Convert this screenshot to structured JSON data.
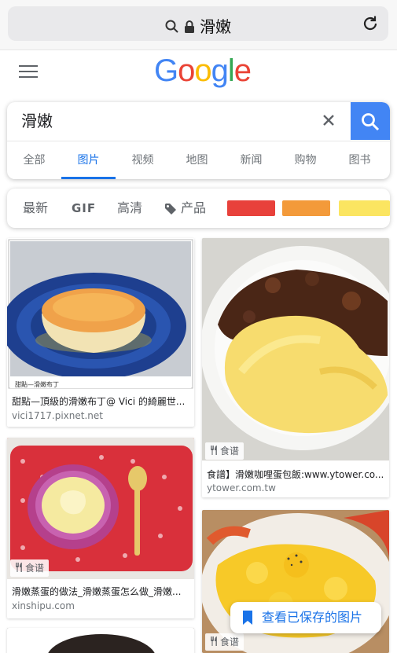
{
  "browser": {
    "url_text": "滑嫩"
  },
  "logo": [
    "G",
    "o",
    "o",
    "g",
    "l",
    "e"
  ],
  "search": {
    "query": "滑嫩"
  },
  "tabs": [
    "全部",
    "图片",
    "视频",
    "地图",
    "新闻",
    "购物",
    "图书"
  ],
  "active_tab": "图片",
  "filters": {
    "latest": "最新",
    "gif": "GIF",
    "hd": "高清",
    "product": "产品"
  },
  "colors": {
    "swatch_red": "#e8413b",
    "swatch_orange": "#f39a3a",
    "swatch_yellow": "#fbe561",
    "accent": "#1a73e8",
    "google_blue": "#4285F4"
  },
  "results": [
    {
      "caption": "甜點—頂級的滑嫩布丁@ Vici 的綺麗世...",
      "domain": "vici1717.pixnet.net",
      "image_text": "甜點—滑嫩布丁"
    },
    {
      "badge": "食谱",
      "caption": "食譜】滑嫩咖哩蛋包飯:www.ytower.co...",
      "domain": "ytower.com.tw"
    },
    {
      "badge": "食谱",
      "caption": "滑嫩蒸蛋的做法_滑嫩蒸蛋怎么做_滑嫩...",
      "domain": "xinshipu.com"
    },
    {
      "badge": "食谱"
    }
  ],
  "saved_button": "查看已保存的图片"
}
